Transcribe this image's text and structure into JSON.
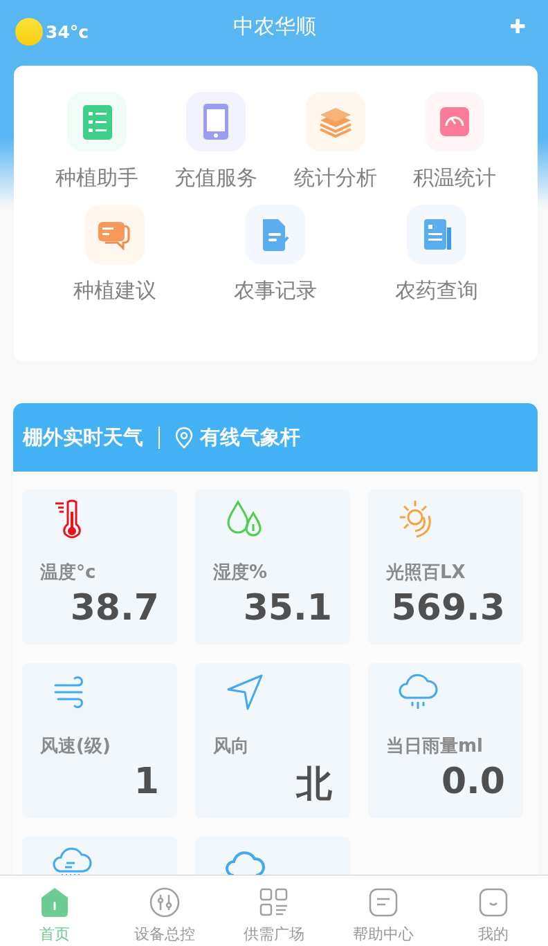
{
  "header": {
    "temperature": "34°c",
    "title": "中农华顺",
    "add": "✚"
  },
  "menu": [
    {
      "label": "种植助手"
    },
    {
      "label": "充值服务"
    },
    {
      "label": "统计分析"
    },
    {
      "label": "积温统计"
    },
    {
      "label": "种植建议"
    },
    {
      "label": "农事记录"
    },
    {
      "label": "农药查询"
    }
  ],
  "weather": {
    "title": "棚外实时天气",
    "station": "有线气象杆",
    "tiles": [
      {
        "kind": "reading",
        "label": "温度°c",
        "value": "38.7"
      },
      {
        "kind": "reading",
        "label": "湿度%",
        "value": "35.1"
      },
      {
        "kind": "reading",
        "label": "光照百LX",
        "value": "569.3"
      },
      {
        "kind": "reading",
        "label": "风速(级)",
        "value": "1"
      },
      {
        "kind": "reading",
        "label": "风向",
        "value": "北"
      },
      {
        "kind": "reading",
        "label": "当日雨量ml",
        "value": "0.0"
      },
      {
        "kind": "cut"
      },
      {
        "kind": "cut"
      }
    ]
  },
  "tab_bar": [
    {
      "label": "首页",
      "selected": true
    },
    {
      "label": "设备总控",
      "selected": false
    },
    {
      "label": "供需广场",
      "selected": false
    },
    {
      "label": "帮助中心",
      "selected": false
    },
    {
      "label": "我的",
      "selected": false
    }
  ]
}
